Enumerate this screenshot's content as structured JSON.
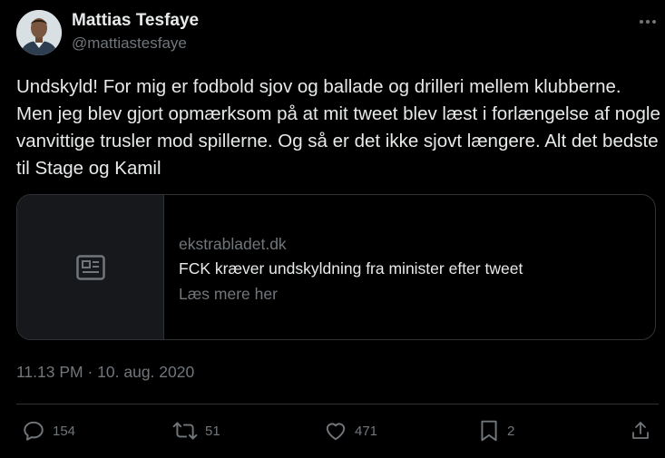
{
  "author": {
    "name": "Mattias Tesfaye",
    "handle": "@mattiastesfaye"
  },
  "tweet": {
    "text": "Undskyld! For mig er fodbold sjov og ballade og drilleri mellem klubberne. Men jeg blev gjort opmærksom på at mit tweet blev læst i forlængelse af nogle vanvittige trusler mod spillerne. Og så er det ikke sjovt længere. Alt det bedste til Stage og Kamil"
  },
  "link_card": {
    "domain": "ekstrabladet.dk",
    "title": "FCK kræver undskyldning fra minister efter tweet",
    "subtitle": "Læs mere her",
    "icon": "article-icon"
  },
  "timestamp": "11.13 PM · 10. aug. 2020",
  "actions": {
    "reply": {
      "icon": "reply-icon",
      "count": "154"
    },
    "retweet": {
      "icon": "retweet-icon",
      "count": "51"
    },
    "like": {
      "icon": "heart-icon",
      "count": "471"
    },
    "bookmark": {
      "icon": "bookmark-icon",
      "count": "2"
    },
    "share": {
      "icon": "share-icon"
    }
  },
  "colors": {
    "background": "#000000",
    "text_primary": "#e7e9ea",
    "text_secondary": "#71767b",
    "border": "#2f3336"
  }
}
